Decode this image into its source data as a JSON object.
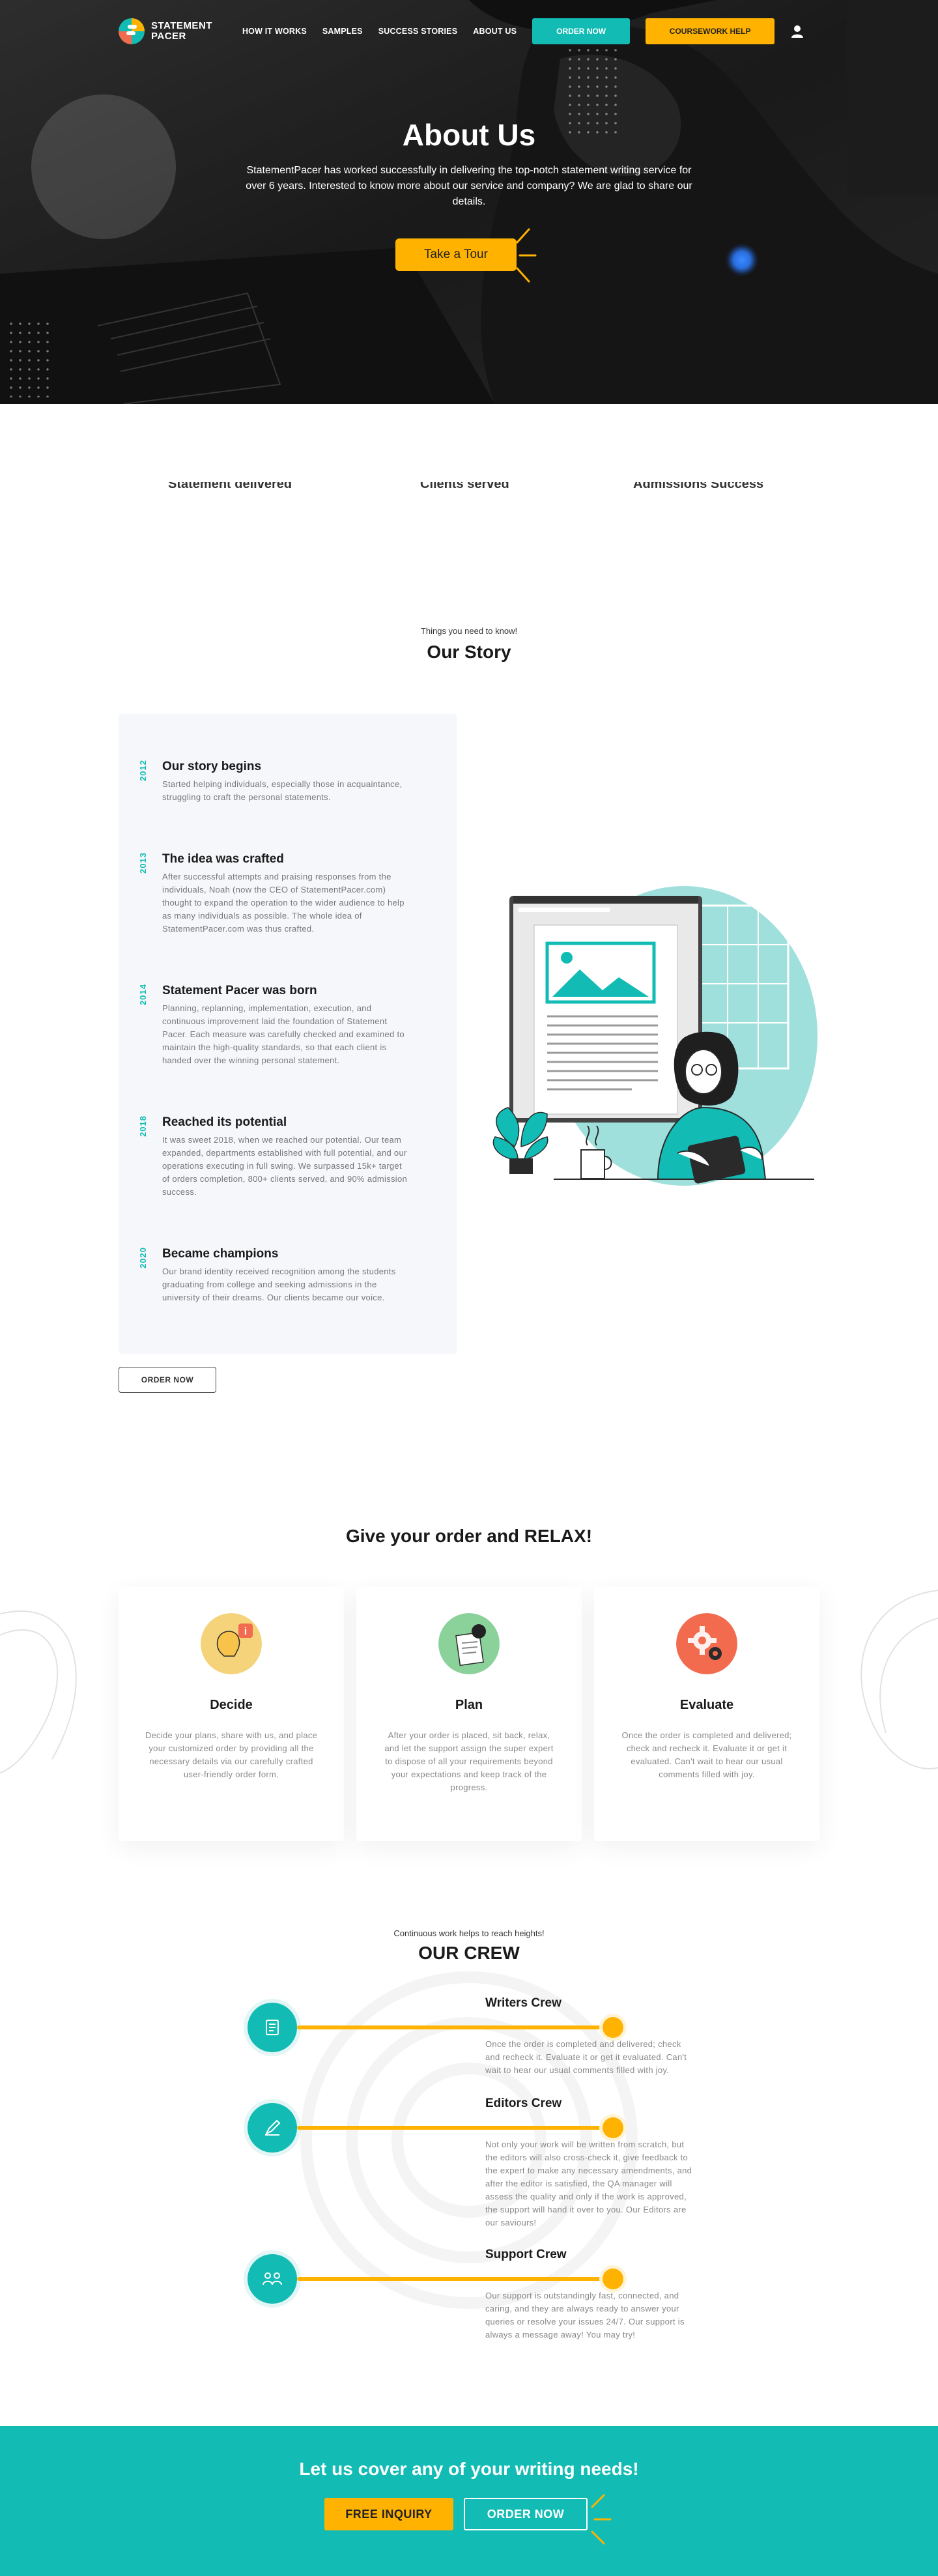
{
  "brand": {
    "line1": "STATEMENT",
    "line2": "PACER"
  },
  "nav": {
    "links": [
      "HOW IT WORKS",
      "SAMPLES",
      "SUCCESS STORIES",
      "ABOUT US"
    ],
    "order_btn": "ORDER NOW",
    "coursework_btn": "COURSEWORK HELP"
  },
  "hero": {
    "title": "About Us",
    "text": "StatementPacer has worked successfully in delivering the top-notch statement writing service for over 6 years. Interested to know more about our service and company? We are glad to share our details.",
    "tour_btn": "Take a Tour"
  },
  "stats": [
    "Statement delivered",
    "Clients served",
    "Admissions Success"
  ],
  "story": {
    "kicker": "Things you need to know!",
    "title": "Our Story",
    "items": [
      {
        "year": "2012",
        "title": "Our story begins",
        "text": "Started helping individuals, especially those in acquaintance, struggling to craft the personal statements."
      },
      {
        "year": "2013",
        "title": "The idea was crafted",
        "text": "After successful attempts and praising responses from the individuals, Noah (now the CEO of StatementPacer.com) thought to expand the operation to the wider audience to help as many individuals as possible. The whole idea of StatementPacer.com was thus crafted."
      },
      {
        "year": "2014",
        "title": "Statement Pacer was born",
        "text": "Planning, replanning, implementation, execution, and continuous improvement laid the foundation of Statement Pacer. Each measure was carefully checked and examined to maintain the high-quality standards, so that each client is handed over the winning personal statement."
      },
      {
        "year": "2018",
        "title": "Reached its potential",
        "text": "It was sweet 2018, when we reached our potential. Our team expanded, departments established with full potential, and our operations executing in full swing. We surpassed 15k+ target of orders completion, 800+ clients served, and 90% admission success."
      },
      {
        "year": "2020",
        "title": "Became champions",
        "text": "Our brand identity received recognition among the students graduating from college and seeking admissions in the university of their dreams. Our clients became our voice."
      }
    ],
    "order_btn": "ORDER NOW"
  },
  "relax": {
    "title": "Give your order and RELAX!",
    "cards": [
      {
        "title": "Decide",
        "text": "Decide your plans, share with us, and place your customized order by providing all the necessary details via our carefully crafted user-friendly order form.",
        "icon": "idea-icon"
      },
      {
        "title": "Plan",
        "text": "After your order is placed, sit back, relax, and let the support assign the super expert to dispose of all your requirements beyond your expectations and keep track of the progress.",
        "icon": "plan-icon"
      },
      {
        "title": "Evaluate",
        "text": "Once the order is completed and delivered; check and recheck it. Evaluate it or get it evaluated. Can't wait to hear our usual comments filled with joy.",
        "icon": "gear-icon"
      }
    ]
  },
  "crew": {
    "kicker": "Continuous work helps to reach heights!",
    "title": "OUR CREW",
    "items": [
      {
        "title": "Writers Crew",
        "text": "Once the order is completed and delivered; check and recheck it. Evaluate it or get it evaluated. Can't wait to hear our usual comments filled with joy.",
        "icon": "document-icon"
      },
      {
        "title": "Editors Crew",
        "text": "Not only your work will be written from scratch, but the editors will also cross-check it, give feedback to the expert to make any necessary amendments, and after the editor is satisfied, the QA manager will assess the quality and only if the work is approved, the support will hand it over to you. Our Editors are our saviours!",
        "icon": "pen-icon"
      },
      {
        "title": "Support Crew",
        "text": "Our support is outstandingly fast, connected, and caring, and they are always ready to answer your queries or resolve your issues 24/7. Our support is always a message away! You may try!",
        "icon": "support-icon"
      }
    ]
  },
  "cta": {
    "title": "Let us cover any of your writing needs!",
    "inquiry_btn": "FREE INQUIRY",
    "order_btn": "ORDER NOW"
  },
  "colors": {
    "teal": "#12bcb4",
    "yellow": "#ffb300",
    "coral": "#f26b4e"
  }
}
